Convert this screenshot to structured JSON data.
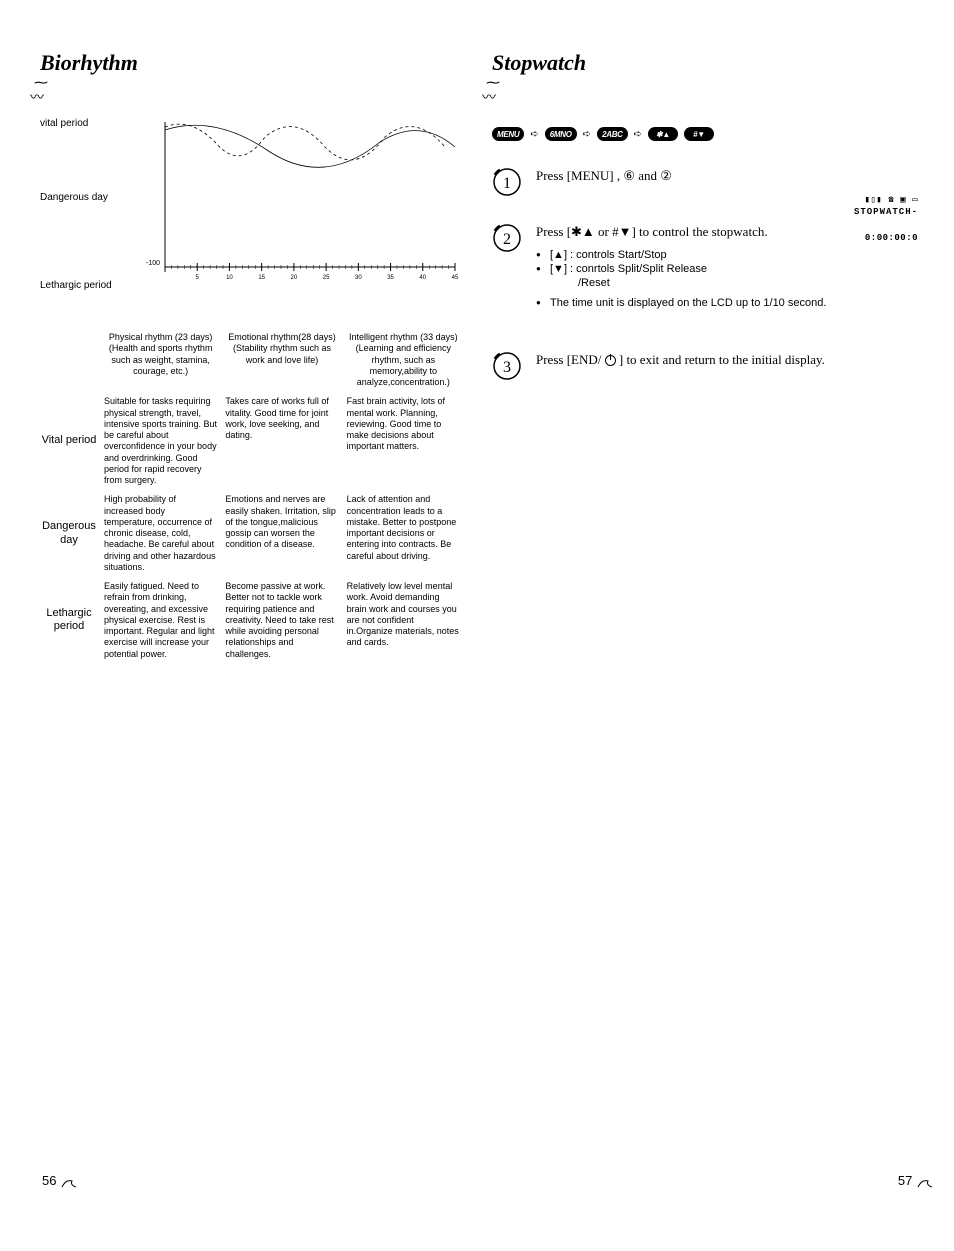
{
  "left": {
    "title": "Biorhythm",
    "chart_labels": {
      "vital": "vital period",
      "dangerous": "Dangerous day",
      "lethargic": "Lethargic period",
      "neg100": "-100"
    },
    "headers": {
      "physical": "Physical rhythm (23 days) (Health and sports rhythm such as weight, stamina, courage, etc.)",
      "emotional": "Emotional rhythm(28 days) (Stability rhythm such as work and love life)",
      "intelligent": "Intelligent rhythm (33 days) (Learning and efficiency rhythm, such as memory,ability to analyze,concentration.)"
    },
    "rows": {
      "vital": {
        "label": "Vital period",
        "physical": "Suitable for tasks requiring physical strength, travel, intensive sports training. But be careful about overconfidence in your body and overdrinking. Good period for rapid recovery from surgery.",
        "emotional": "Takes care of works full of vitality. Good time for joint work, love seeking, and dating.",
        "intelligent": "Fast brain activity, lots of mental work. Planning, reviewing. Good time to make decisions about important matters."
      },
      "dangerous": {
        "label": "Dangerous day",
        "physical": "High probability of increased body temperature, occurrence of chronic disease, cold, headache. Be careful about driving and other hazardous situations.",
        "emotional": "Emotions and nerves are easily shaken. Irritation, slip of the tongue,malicious gossip can worsen the condition of a disease.",
        "intelligent": "Lack of attention and concentration leads to a mistake. Better to postpone important decisions or entering into contracts. Be careful about driving."
      },
      "lethargic": {
        "label": "Lethargic period",
        "physical": "Easily fatigued. Need to refrain from drinking, overeating, and excessive physical exercise. Rest is important. Regular and light exercise will increase your potential power.",
        "emotional": "Become passive at work. Better not to tackle work requiring patience and creativity. Need to take rest while avoiding personal relationships and challenges.",
        "intelligent": "Relatively low level mental work. Avoid demanding brain work and courses you are not confident in.Organize materials, notes and cards."
      }
    },
    "page_num": "56"
  },
  "right": {
    "title": "Stopwatch",
    "crumbs": [
      "MENU",
      "6MNO",
      "2ABC",
      "✱▲",
      "#▼"
    ],
    "step1": "Press [MENU] , ⑥ and ②",
    "step2": {
      "lead": "Press [✱▲ or #▼] to control the stopwatch.",
      "b1": "[▲] : controls Start/Stop",
      "b2": "[▼] : conrtols Split/Split Release",
      "b2b": "/Reset",
      "b3": "The time unit is displayed on the LCD up to 1/10 second."
    },
    "step3_a": "Press [END/ ",
    "step3_b": " ] to exit and return to the initial display.",
    "lcd": {
      "title": "STOPWATCH-",
      "time": "0:00:00:0"
    },
    "page_num": "57"
  },
  "chart_data": {
    "type": "line",
    "title": "Biorhythm",
    "xlabel": "",
    "ylabel": "",
    "x_ticks": [
      5,
      10,
      15,
      20,
      25,
      30,
      35,
      40,
      45
    ],
    "ylim": [
      -100,
      100
    ],
    "y_categories": [
      "vital period",
      "Dangerous day",
      "Lethargic period"
    ],
    "series": [
      {
        "name": "Physical (23 days)",
        "period_days": 23
      },
      {
        "name": "Emotional (28 days)",
        "period_days": 28
      },
      {
        "name": "Intelligent (33 days)",
        "period_days": 33
      }
    ],
    "note": "Curves are schematic sine waves; exact amplitudes not labeled on source."
  }
}
